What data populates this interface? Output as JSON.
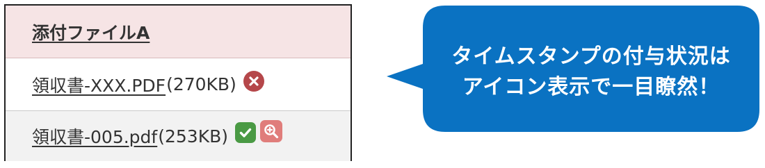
{
  "attachments": {
    "header": "添付ファイルA",
    "files": [
      {
        "name": "領収書-XXX.PDF",
        "size": "(270KB)",
        "status_icon": "error-x-icon",
        "status_color": "#b5474a"
      },
      {
        "name": "領収書-005.pdf",
        "size": "(253KB)",
        "status_icon": "check-icon",
        "status_color": "#4a9a44",
        "action_icon": "zoom-in-icon",
        "action_color": "#e07d7b"
      }
    ]
  },
  "callout": {
    "line1": "タイムスタンプの付与状況は",
    "line2": "アイコン表示で一目瞭然！",
    "color": "#0a72c2"
  }
}
